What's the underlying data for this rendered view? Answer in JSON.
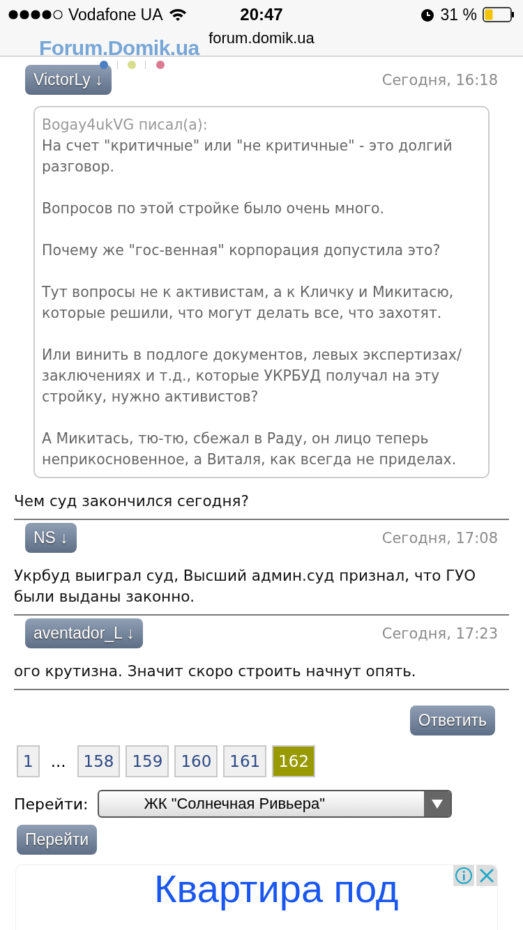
{
  "status_bar": {
    "carrier": "Vodafone UA",
    "time": "20:47",
    "battery": "31 %"
  },
  "address_bar": {
    "url": "forum.domik.ua"
  },
  "logo": "Forum.Domik.ua",
  "posts": [
    {
      "author": "VictorLy ↓",
      "time": "Сегодня, 16:18",
      "quote": {
        "source": "Bogay4ukVG писал(а):",
        "paragraphs": [
          "На счет \"критичные\" или \"не критичные\" - это долгий разговор.",
          "Вопросов по этой стройке было очень много.",
          "Почему же \"гос-венная\" корпорация допустила это?",
          "Тут вопросы не к активистам, а к Кличку и Микитасю, которые решили, что могут делать все, что захотят.",
          "Или винить в подлоге документов, левых экспертизах/заключениях и т.д., которые УКРБУД получал на эту стройку, нужно активистов?",
          "А Микитась, тю-тю, сбежал в Раду, он лицо теперь неприкосновенное, а Виталя, как всегда не приделах."
        ]
      },
      "text": "Чем суд закончился сегодня?"
    },
    {
      "author": "NS  ↓",
      "time": "Сегодня, 17:08",
      "text": "Укрбуд выиграл суд, Высший админ.суд признал, что ГУО были выданы законно."
    },
    {
      "author": "aventador_L ↓",
      "time": "Сегодня, 17:23",
      "text": "ого крутизна. Значит скоро строить начнут опять."
    }
  ],
  "reply_button": "Ответить",
  "pagination": [
    {
      "kind": "page",
      "label": "1",
      "selected": false
    },
    {
      "kind": "ellipsis",
      "label": "..."
    },
    {
      "kind": "page",
      "label": "158",
      "selected": false
    },
    {
      "kind": "page",
      "label": "159",
      "selected": false
    },
    {
      "kind": "page",
      "label": "160",
      "selected": false
    },
    {
      "kind": "page",
      "label": "161",
      "selected": false
    },
    {
      "kind": "page",
      "label": "162",
      "selected": true
    }
  ],
  "jump": {
    "label": "Перейти:",
    "value": "ЖК \"Солнечная Ривьера\"",
    "button": "Перейти"
  },
  "ad": {
    "headline": "Квартира под"
  }
}
